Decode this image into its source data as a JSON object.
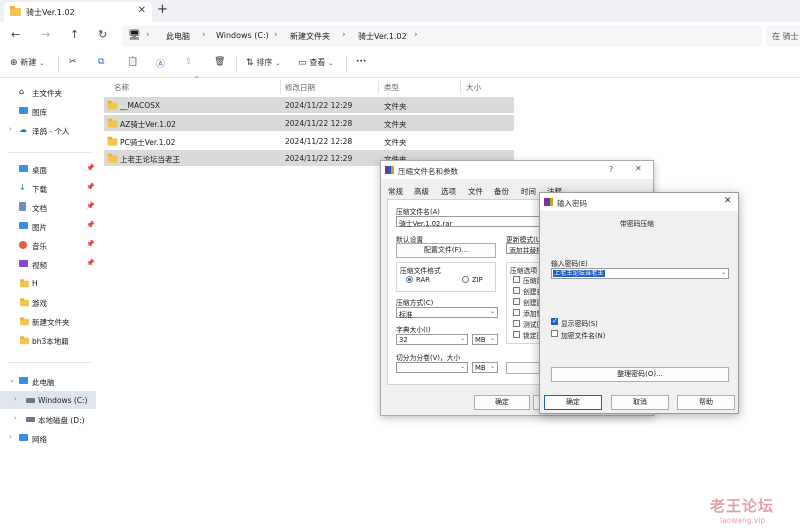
{
  "window": {
    "tab_title": "骑士Ver.1.02",
    "close_glyph": "✕",
    "new_tab_glyph": "+"
  },
  "nav": {
    "back": "←",
    "forward": "→",
    "up": "↑",
    "refresh": "↻",
    "breadcrumbs": [
      "此电脑",
      "Windows (C:)",
      "新建文件夹",
      "骑士Ver.1.02"
    ],
    "sep": "›",
    "search_placeholder": "在 骑士"
  },
  "toolbar": {
    "new_label": "新建",
    "sort_label": "排序",
    "view_label": "查看",
    "more": "···"
  },
  "sidebar": {
    "quick": [
      {
        "label": "主文件夹"
      },
      {
        "label": "图库"
      },
      {
        "label": "泽鸽 - 个人"
      }
    ],
    "pinned": [
      {
        "label": "桌面"
      },
      {
        "label": "下载"
      },
      {
        "label": "文档"
      },
      {
        "label": "图片"
      },
      {
        "label": "音乐"
      },
      {
        "label": "视频"
      },
      {
        "label": "H"
      },
      {
        "label": "游戏"
      },
      {
        "label": "新建文件夹"
      },
      {
        "label": "bh3本地籍"
      }
    ],
    "pc": [
      {
        "label": "此电脑"
      },
      {
        "label": "Windows (C:)"
      },
      {
        "label": "本地磁盘 (D:)"
      },
      {
        "label": "网络"
      }
    ]
  },
  "filelist": {
    "columns": [
      "名称",
      "修改日期",
      "类型",
      "大小"
    ],
    "rows": [
      {
        "name": "__MACOSX",
        "date": "2024/11/22 12:29",
        "type": "文件夹",
        "selected": true
      },
      {
        "name": "AZ骑士Ver.1.02",
        "date": "2024/11/22 12:28",
        "type": "文件夹",
        "selected": true
      },
      {
        "name": "PC骑士Ver.1.02",
        "date": "2024/11/22 12:28",
        "type": "文件夹",
        "selected": false
      },
      {
        "name": "上老王论坛当老王",
        "date": "2024/11/22 12:29",
        "type": "文件夹",
        "selected": true
      }
    ]
  },
  "archive_dialog": {
    "title": "压缩文件名和参数",
    "help": "?",
    "tabs": [
      "常规",
      "高级",
      "选项",
      "文件",
      "备份",
      "时间",
      "注释"
    ],
    "archive_name_label": "压缩文件名(A)",
    "archive_name_value": "骑士Ver.1.02.rar",
    "default_settings_label": "默认设置",
    "profiles_button": "配置文件(F)...",
    "update_mode_label": "更新模式(U)",
    "update_mode_value": "添加并替换",
    "format_group": "压缩文件格式",
    "format_rar": "RAR",
    "format_zip": "ZIP",
    "options_group": "压缩选项",
    "options": [
      "压缩后",
      "创建自",
      "创建固",
      "添加恢",
      "测试压",
      "锁定压"
    ],
    "method_label": "压缩方式(C)",
    "method_value": "标准",
    "dict_label": "字典大小(I)",
    "dict_value": "32",
    "dict_unit": "MB",
    "split_label": "切分为分卷(V)，大小",
    "split_unit": "MB",
    "ok_button": "确定"
  },
  "password_dialog": {
    "title": "输入密码",
    "close": "✕",
    "subtitle": "带密码压缩",
    "password_label": "输入密码(E)",
    "password_value": "上老王论坛当老王",
    "show_password_label": "显示密码(S)",
    "encrypt_names_label": "加密文件名(N)",
    "organize_button": "整理密码(O)...",
    "ok_button": "确定",
    "cancel_button": "取消",
    "help_button": "帮助"
  },
  "watermark": {
    "text": "老王论坛",
    "url": "laowang.vip"
  }
}
